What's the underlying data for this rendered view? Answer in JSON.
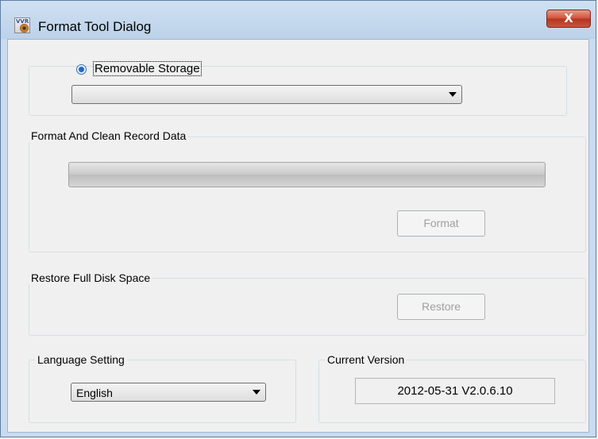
{
  "window": {
    "title": "Format Tool Dialog",
    "app_icon_text": "VVR",
    "close_symbol": "X"
  },
  "storage": {
    "radio_label": "Removable Storage",
    "radio_selected": true,
    "device_value": ""
  },
  "format_group": {
    "legend": "Format And Clean Record Data",
    "progress": 0,
    "button_label": "Format",
    "button_enabled": false
  },
  "restore_group": {
    "legend": "Restore Full Disk Space",
    "button_label": "Restore",
    "button_enabled": false
  },
  "language_group": {
    "legend": "Language Setting",
    "selected": "English"
  },
  "version_group": {
    "legend": "Current Version",
    "value": "2012-05-31 V2.0.6.10"
  },
  "icons": {
    "app": "format-tool-app-icon",
    "close": "close-icon",
    "dropdown": "chevron-down-icon"
  },
  "colors": {
    "title_bar": "#bcd2ea",
    "close_button": "#c8553c",
    "client_bg": "#f0f0f0",
    "radio_dot": "#1a66c2"
  }
}
